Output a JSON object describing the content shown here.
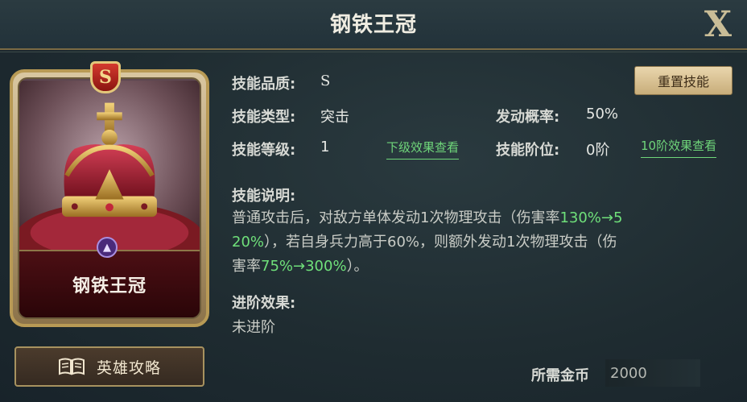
{
  "header": {
    "title": "钢铁王冠",
    "close_label": "X"
  },
  "card": {
    "grade": "S",
    "name": "钢铁王冠"
  },
  "guide_button": {
    "label": "英雄攻略"
  },
  "skill": {
    "quality_label": "技能品质:",
    "quality_value": "S",
    "type_label": "技能类型:",
    "type_value": "突击",
    "chance_label": "发动概率:",
    "chance_value": "50%",
    "level_label": "技能等级:",
    "level_value": "1",
    "next_level_link": "下级效果查看",
    "tier_label": "技能阶位:",
    "tier_value": "0阶",
    "tier10_link": "10阶效果查看",
    "reset_label": "重置技能"
  },
  "description": {
    "label": "技能说明:",
    "line1_a": "普通攻击后，对敌方单体发动1次物理攻击（伤害率",
    "line1_hl": "130%→5",
    "line2_hl": "20%",
    "line2_a": "），若自身兵力高于60%，则额外发动1次物理攻击（伤",
    "line3_a": "害率",
    "line3_hl": "75%→300%",
    "line3_b": "）。"
  },
  "advance": {
    "label": "进阶效果:",
    "value": "未进阶"
  },
  "cost": {
    "label": "所需金币",
    "value": "2000"
  },
  "icons": [
    "close-icon",
    "grade-s-badge-icon",
    "crown-icon",
    "type-emblem-icon",
    "book-icon"
  ],
  "colors": {
    "highlight": "#6fe07a",
    "link": "#6fd67a",
    "gold_border": "#b89a55",
    "reset_button": "#d9c296"
  }
}
